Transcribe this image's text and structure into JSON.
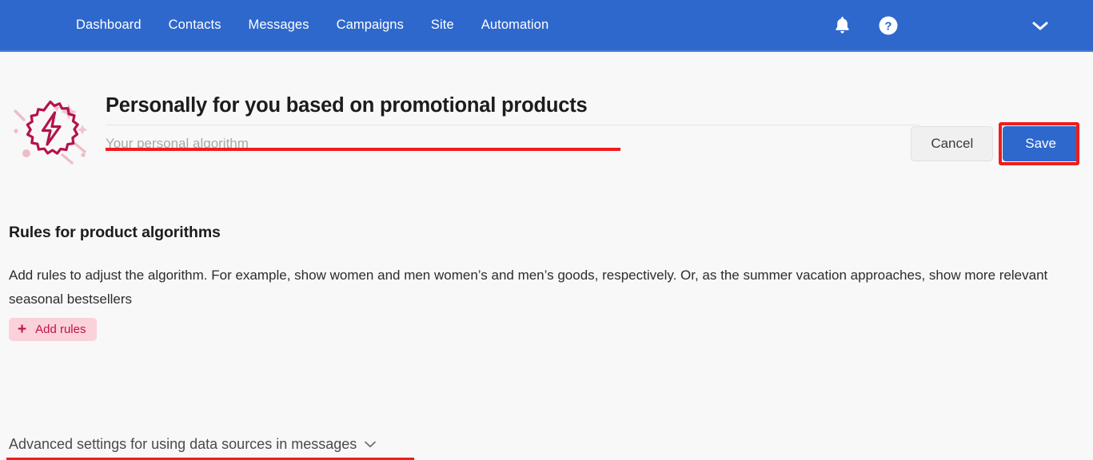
{
  "topnav": {
    "items": [
      {
        "label": "Dashboard"
      },
      {
        "label": "Contacts"
      },
      {
        "label": "Messages"
      },
      {
        "label": "Campaigns"
      },
      {
        "label": "Site"
      },
      {
        "label": "Automation"
      }
    ],
    "icons": {
      "notifications": "bell-icon",
      "help": "question-mark-circle-icon",
      "account_menu": "chevron-down-icon"
    },
    "background_color": "#2e68cc"
  },
  "header": {
    "brand_icon": "badge-lightning-bolt-icon",
    "title": "Personally for you based on promotional products",
    "subtitle_placeholder": "Your personal algorithm",
    "subtitle_value": "",
    "cancel_label": "Cancel",
    "save_label": "Save",
    "save_color": "#2e68cc"
  },
  "rules": {
    "section_title": "Rules for product algorithms",
    "description": "Add rules to adjust the algorithm. For example, show women and men women’s and men’s goods, respectively. Or, as the summer vacation approaches, show more relevant seasonal bestsellers",
    "add_rules_label": "Add rules",
    "add_rules_plus": "+",
    "add_rules_bg": "#fbd2d9",
    "add_rules_fg": "#c2123f"
  },
  "advanced": {
    "label": "Advanced settings for using data sources in messages",
    "chevron": "chevron-down-icon"
  },
  "annotations": {
    "highlight_color": "#f01c1c",
    "title_underline": "title-red-underline",
    "save_box": "save-button-red-box",
    "advanced_underline": "advanced-settings-red-underline"
  }
}
